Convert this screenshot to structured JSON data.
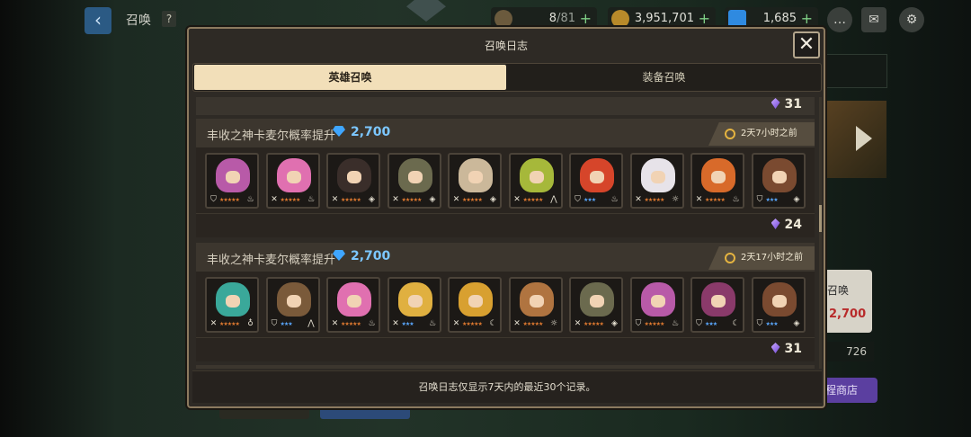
{
  "header": {
    "back_icon": "chevron-left-icon",
    "title": "召唤",
    "help": "?"
  },
  "resources": {
    "stamina": {
      "current": "8",
      "max": "/81",
      "icon": "coffee-cup-icon"
    },
    "gold": {
      "value": "3,951,701",
      "icon": "gold-coin-icon"
    },
    "gems": {
      "value": "1,685",
      "icon": "diamond-icon"
    }
  },
  "top_icons": [
    "chat-icon",
    "mail-icon",
    "settings-gear-icon"
  ],
  "background": {
    "card_text": "召唤",
    "card_price": "2,700",
    "count": "726",
    "shop_label": "程商店"
  },
  "modal": {
    "title": "召唤日志",
    "close_label": "✕",
    "tabs": [
      {
        "label": "英雄召唤",
        "active": true
      },
      {
        "label": "装备召唤",
        "active": false
      }
    ],
    "prev_count": "31",
    "records": [
      {
        "title": "丰收之神卡麦尔概率提升",
        "price": "2,700",
        "time": "2天7小时之前",
        "count": "24",
        "heroes": [
          {
            "name": "pink-hair-cat-girl",
            "color": "#b85aa8",
            "role": "shield",
            "stars": "★★★★★",
            "element": "fire"
          },
          {
            "name": "pink-hair-girl",
            "color": "#e070b0",
            "role": "sword",
            "stars": "★★★★★",
            "element": "fire"
          },
          {
            "name": "black-cloak-knight",
            "color": "#3a2e2a",
            "role": "sword",
            "stars": "★★★★★",
            "element": "basic"
          },
          {
            "name": "soldier-boy",
            "color": "#6b6a4e",
            "role": "sword",
            "stars": "★★★★★",
            "element": "basic"
          },
          {
            "name": "beige-hood-girl",
            "color": "#cbb89a",
            "role": "sword",
            "stars": "★★★★★",
            "element": "basic"
          },
          {
            "name": "green-hair-elf",
            "color": "#a6b83a",
            "role": "sword",
            "stars": "★★★★★",
            "element": "earth"
          },
          {
            "name": "red-fox-spirit",
            "color": "#d6452a",
            "role": "shield",
            "stars": "★★★",
            "element": "fire"
          },
          {
            "name": "white-tiger",
            "color": "#e7e3e9",
            "role": "sword",
            "stars": "★★★★★",
            "element": "light"
          },
          {
            "name": "orange-fox-girl",
            "color": "#d86a2a",
            "role": "sword",
            "stars": "★★★★★",
            "element": "fire"
          },
          {
            "name": "brown-hair-girl",
            "color": "#7a4a30",
            "role": "shield",
            "stars": "★★★",
            "element": "basic"
          }
        ]
      },
      {
        "title": "丰收之神卡麦尔概率提升",
        "price": "2,700",
        "time": "2天17小时之前",
        "count": "31",
        "heroes": [
          {
            "name": "teal-hair-mage",
            "color": "#3aa89a",
            "role": "sword",
            "stars": "★★★★★",
            "element": "water"
          },
          {
            "name": "stone-golem",
            "color": "#7a5a3a",
            "role": "shield",
            "stars": "★★★",
            "element": "earth"
          },
          {
            "name": "pink-hair-girl",
            "color": "#e070b0",
            "role": "sword",
            "stars": "★★★★★",
            "element": "fire"
          },
          {
            "name": "blonde-warrior",
            "color": "#e0b040",
            "role": "sword",
            "stars": "★★★",
            "element": "fire"
          },
          {
            "name": "blonde-vampire",
            "color": "#d8a030",
            "role": "sword",
            "stars": "★★★★★",
            "element": "dark"
          },
          {
            "name": "monkey-boy",
            "color": "#b07440",
            "role": "sword",
            "stars": "★★★★★",
            "element": "light"
          },
          {
            "name": "soldier-boy",
            "color": "#6b6a4e",
            "role": "sword",
            "stars": "★★★★★",
            "element": "basic"
          },
          {
            "name": "pink-hair-cat-girl",
            "color": "#b85aa8",
            "role": "shield",
            "stars": "★★★★★",
            "element": "fire"
          },
          {
            "name": "horned-demon-girl",
            "color": "#8a3a6a",
            "role": "shield",
            "stars": "★★★",
            "element": "dark"
          },
          {
            "name": "brown-hair-girl",
            "color": "#7a4a30",
            "role": "shield",
            "stars": "★★★",
            "element": "basic"
          }
        ]
      }
    ],
    "footer_note": "召唤日志仅显示7天内的最近30个记录。"
  }
}
